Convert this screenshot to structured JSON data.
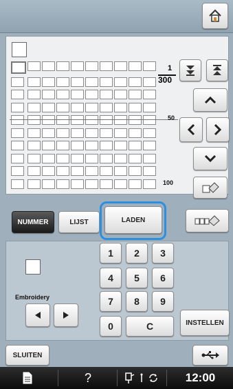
{
  "ratio": {
    "numerator": "1",
    "denominator": "300"
  },
  "scale": {
    "mid": "50",
    "bottom": "100"
  },
  "tabs": {
    "nummer": "NUMMER",
    "lijst": "LIJST",
    "laden": "LADEN"
  },
  "keypad": {
    "keys": [
      "1",
      "2",
      "3",
      "4",
      "5",
      "6",
      "7",
      "8",
      "9",
      "0",
      "C"
    ],
    "settings": "INSTELLEN"
  },
  "labels": {
    "category": "Embroidery"
  },
  "footer": {
    "close": "SLUITEN",
    "time": "12:00",
    "help": "?"
  },
  "icons": {
    "home": "home-icon",
    "scroll_bottom": "scroll-to-bottom-icon",
    "scroll_top": "scroll-to-top-icon",
    "up": "arrow-up-icon",
    "down": "arrow-down-icon",
    "left": "arrow-left-icon",
    "right": "arrow-right-icon",
    "erase": "eraser-icon",
    "erase_all": "erase-all-icon",
    "usb": "usb-icon",
    "document": "document-icon"
  }
}
